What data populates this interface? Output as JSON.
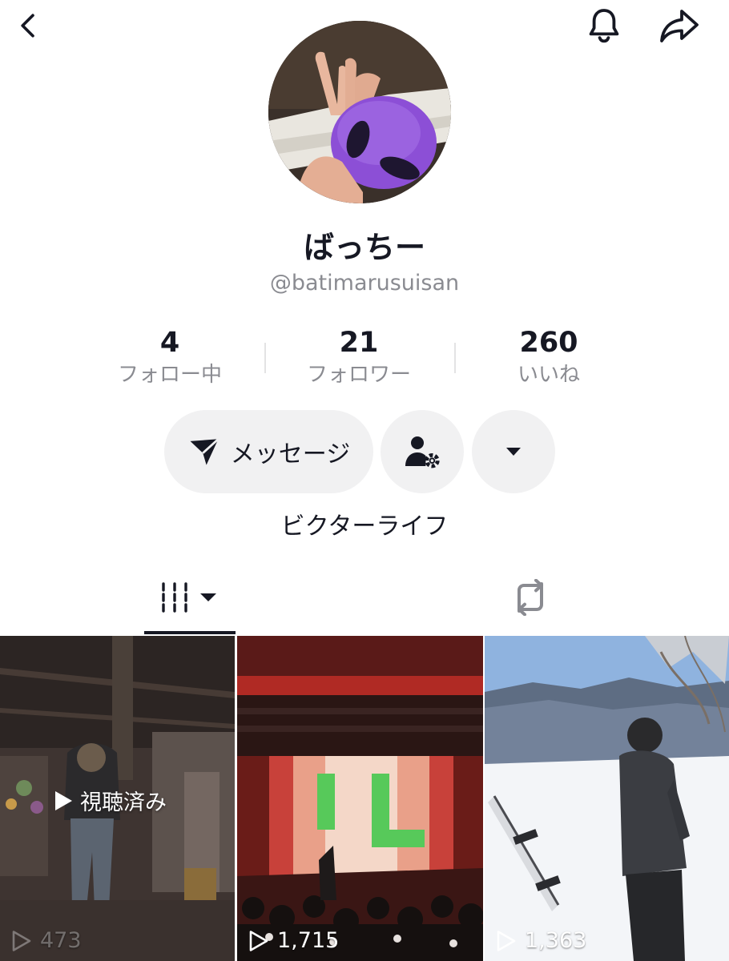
{
  "profile": {
    "display_name": "ばっちー",
    "username": "@batimarusuisan",
    "bio": "ビクターライフ"
  },
  "stats": [
    {
      "value": "4",
      "label": "フォロー中"
    },
    {
      "value": "21",
      "label": "フォロワー"
    },
    {
      "value": "260",
      "label": "いいね"
    }
  ],
  "actions": {
    "message_label": "メッセージ"
  },
  "icons": {
    "back": "chevron-left-icon",
    "notifications": "bell-icon",
    "share": "share-arrow-icon",
    "message": "send-icon",
    "friend_settings": "person-gear-icon",
    "more": "caret-down-icon",
    "videos_tab": "grid-columns-icon",
    "reposts_tab": "repost-icon",
    "play": "play-outline-icon"
  },
  "videos": [
    {
      "views": "473",
      "badge": "視聴済み"
    },
    {
      "views": "1,715"
    },
    {
      "views": "1,363"
    }
  ],
  "colors": {
    "text_primary": "#161823",
    "text_secondary": "#8a8b91",
    "button_bg": "#f1f1f2",
    "avatar_accent": "#8c4fd6"
  }
}
